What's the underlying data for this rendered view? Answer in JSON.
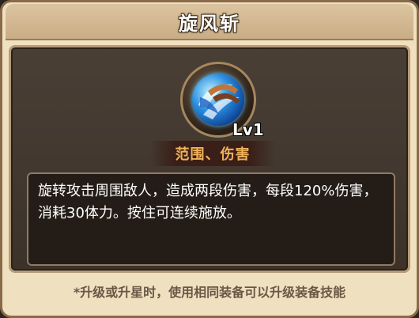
{
  "title": "旋风斩",
  "skill": {
    "icon": "whirlwind-slash-icon",
    "level": "Lv1",
    "tags": "范围、伤害",
    "description": "旋转攻击周围敌人，造成两段伤害，每段120%伤害，消耗30体力。按住可连续施放。"
  },
  "footer_note": "*升级或升星时，使用相同装备可以升级装备技能",
  "colors": {
    "accent_tag": "#f0b25a",
    "panel_bg": "#efe0c0",
    "inner_bg": "#3b322a"
  }
}
